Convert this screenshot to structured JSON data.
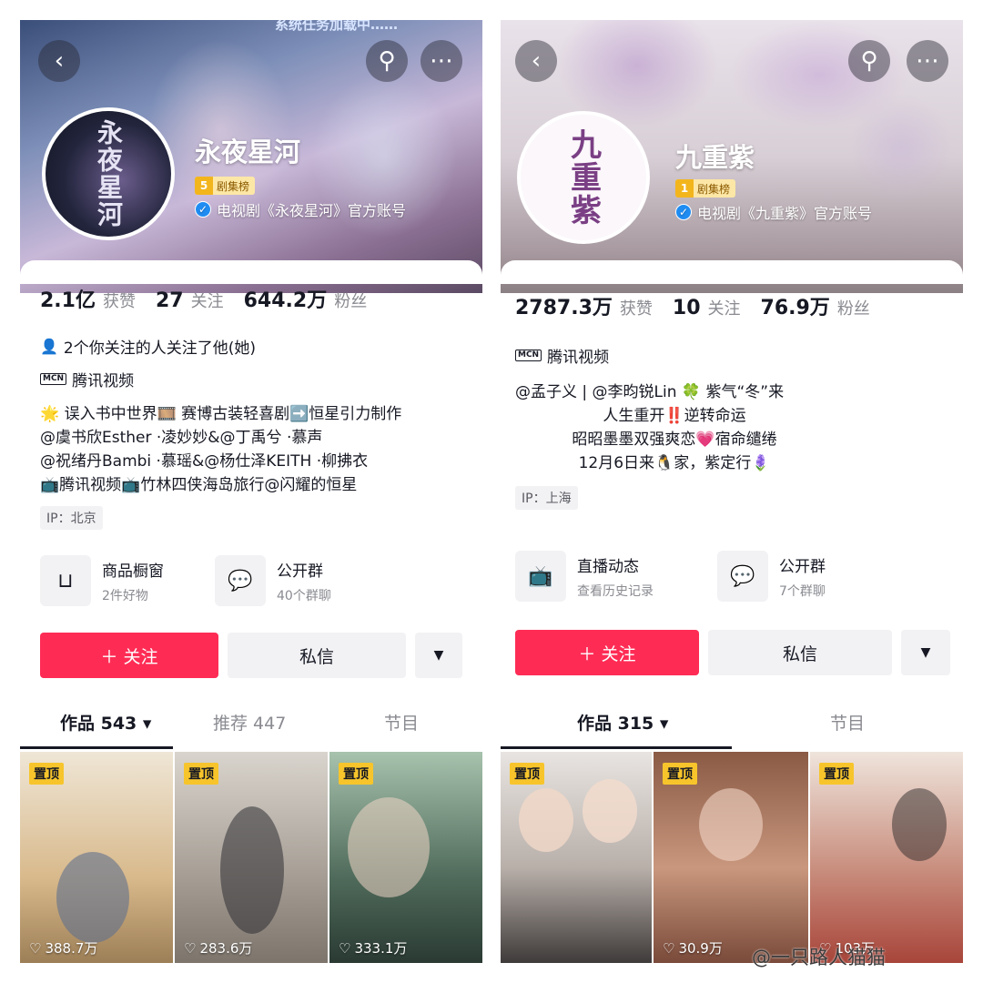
{
  "left": {
    "banner_text": "系统任务加载中……",
    "name": "永夜星河",
    "avatar_text": "永夜星河",
    "rank_num": "5",
    "rank_label": "剧集榜",
    "verify": "电视剧《永夜星河》官方账号",
    "stats": [
      {
        "value": "2.1亿",
        "label": "获赞"
      },
      {
        "value": "27",
        "label": "关注"
      },
      {
        "value": "644.2万",
        "label": "粉丝"
      }
    ],
    "mutual": "2个你关注的人关注了他(她)",
    "mcn": "MCN",
    "org": "腾讯视频",
    "bio": [
      "🌟 误入书中世界🎞️ 赛博古装轻喜剧➡️恒星引力制作",
      "@虞书欣Esther ·凌妙妙&@丁禹兮 ·慕声",
      "@祝绪丹Bambi ·慕瑶&@杨仕泽KEITH ·柳拂衣",
      "📺腾讯视频📺竹林四侠海岛旅行@闪耀的恒星"
    ],
    "ip": "IP：北京",
    "services": [
      {
        "icon": "bag-icon",
        "glyph": "⊔",
        "title": "商品橱窗",
        "sub": "2件好物"
      },
      {
        "icon": "chat-icon",
        "glyph": "💬",
        "title": "公开群",
        "sub": "40个群聊"
      }
    ],
    "follow": "＋ 关注",
    "message": "私信",
    "more": "▼",
    "tabs": [
      "作品 543 ▾",
      "推荐 447",
      "节目"
    ],
    "videos": [
      {
        "pin": "置顶",
        "likes": "388.7万",
        "color": "#d9c3a0"
      },
      {
        "pin": "置顶",
        "likes": "283.6万",
        "color": "#b9b3ac"
      },
      {
        "pin": "置顶",
        "likes": "333.1万",
        "color": "#6e8a74"
      }
    ]
  },
  "right": {
    "name": "九重紫",
    "avatar_text": "九重紫",
    "rank_num": "1",
    "rank_label": "剧集榜",
    "verify": "电视剧《九重紫》官方账号",
    "stats": [
      {
        "value": "2787.3万",
        "label": "获赞"
      },
      {
        "value": "10",
        "label": "关注"
      },
      {
        "value": "76.9万",
        "label": "粉丝"
      }
    ],
    "mcn": "MCN",
    "org": "腾讯视频",
    "bio": [
      "@孟子义 | @李昀锐Lin 🍀 紫气“冬”来",
      "人生重开‼️逆转命运",
      "昭昭墨墨双强爽恋💗宿命缱绻",
      "12月6日来🐧家，紫定行🪻"
    ],
    "ip": "IP：上海",
    "services": [
      {
        "icon": "tv-icon",
        "glyph": "📺",
        "title": "直播动态",
        "sub": "查看历史记录"
      },
      {
        "icon": "chat-icon",
        "glyph": "💬",
        "title": "公开群",
        "sub": "7个群聊"
      }
    ],
    "follow": "＋ 关注",
    "message": "私信",
    "more": "▼",
    "tabs": [
      "作品 315 ▾",
      "节目"
    ],
    "videos": [
      {
        "pin": "置顶",
        "likes": "",
        "color": "#cfc8c3"
      },
      {
        "pin": "置顶",
        "likes": "30.9万",
        "color": "#b58670"
      },
      {
        "pin": "置顶",
        "likes": "103万",
        "color": "#d7b3a8"
      }
    ]
  },
  "watermark": "@一只路人猫猫",
  "colors": {
    "accent": "#fe2c55",
    "pin": "#f7c52b",
    "verify": "#1f8cf2"
  }
}
